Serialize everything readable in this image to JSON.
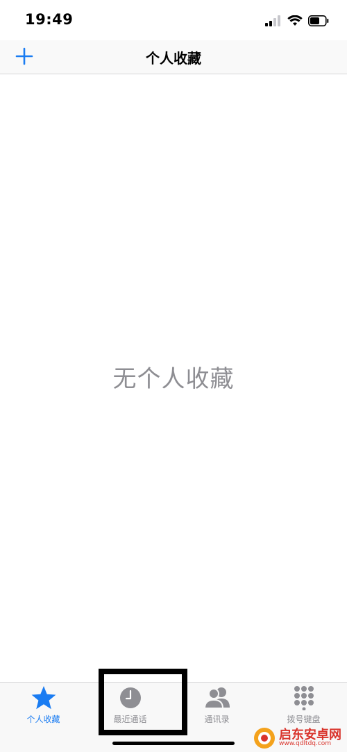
{
  "status_bar": {
    "time": "19:49"
  },
  "nav": {
    "title": "个人收藏",
    "add_icon": "plus-icon"
  },
  "empty_state": {
    "text": "无个人收藏"
  },
  "tabs": [
    {
      "label": "个人收藏",
      "icon": "star-icon",
      "active": true
    },
    {
      "label": "最近通话",
      "icon": "clock-icon",
      "active": false
    },
    {
      "label": "通讯录",
      "icon": "contacts-icon",
      "active": false
    },
    {
      "label": "拨号键盘",
      "icon": "keypad-icon",
      "active": false
    }
  ],
  "watermark": {
    "title": "启东安卓网",
    "url": "www.qdltdq.com"
  },
  "colors": {
    "accent": "#1a7cf2",
    "inactive": "#8e8e93",
    "watermark": "#d9332b"
  }
}
